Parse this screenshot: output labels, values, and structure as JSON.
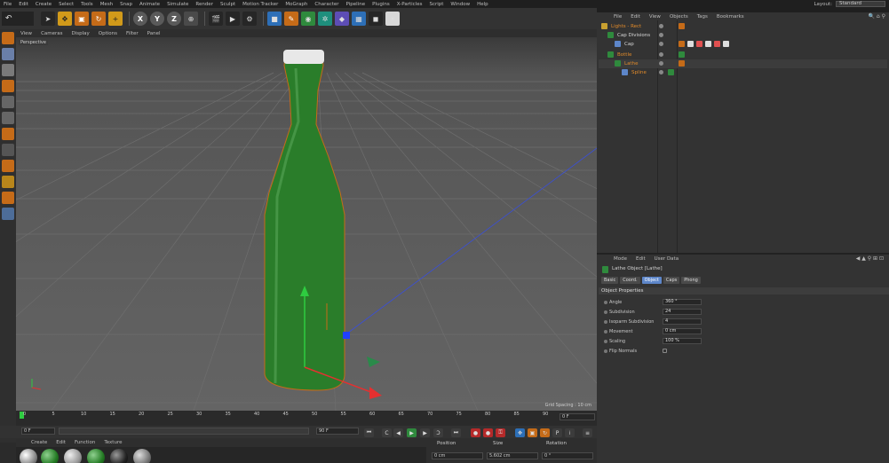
{
  "menubar": {
    "items": [
      "File",
      "Edit",
      "Create",
      "Select",
      "Tools",
      "Mesh",
      "Snap",
      "Animate",
      "Simulate",
      "Render",
      "Sculpt",
      "Motion Tracker",
      "MoGraph",
      "Character",
      "Pipeline",
      "Plugins",
      "X-Particles",
      "Script",
      "Window",
      "Help"
    ],
    "layout_label": "Layout:",
    "layout_value": "Standard"
  },
  "toolbar": {
    "undo_icon": "↶",
    "axis_x": "X",
    "axis_y": "Y",
    "axis_z": "Z"
  },
  "viewport": {
    "menu": [
      "View",
      "Cameras",
      "Display",
      "Options",
      "Filter",
      "Panel"
    ],
    "label": "Perspective",
    "grid_spacing": "Grid Spacing : 10 cm"
  },
  "timeline": {
    "ticks": [
      "0",
      "5",
      "10",
      "15",
      "20",
      "25",
      "30",
      "35",
      "40",
      "45",
      "50",
      "55",
      "60",
      "65",
      "70",
      "75",
      "80",
      "85",
      "90"
    ],
    "start_frame": "0 F",
    "current_field": "0 F",
    "end_frame": "90 F",
    "end_frame_right": "0 F"
  },
  "materials": {
    "menu": [
      "Create",
      "Edit",
      "Function",
      "Texture"
    ]
  },
  "coordinates": {
    "headers": [
      "Position",
      "Size",
      "Rotation"
    ],
    "values": [
      "0 cm",
      "5.602 cm",
      "0 °"
    ]
  },
  "object_manager": {
    "menu": [
      "File",
      "Edit",
      "View",
      "Objects",
      "Tags",
      "Bookmarks"
    ],
    "objects": [
      {
        "name": "Lights - Rect",
        "color": "orange"
      },
      {
        "name": "Cap Divisions",
        "color": "white"
      },
      {
        "name": "Cap",
        "color": "white"
      },
      {
        "name": "Bottle",
        "color": "orange"
      },
      {
        "name": "Lathe",
        "color": "orange"
      },
      {
        "name": "Spline",
        "color": "orange"
      }
    ]
  },
  "attribute_manager": {
    "menu": [
      "Mode",
      "Edit",
      "User Data"
    ],
    "title": "Lathe Object [Lathe]",
    "tabs": [
      "Basic",
      "Coord.",
      "Object",
      "Caps",
      "Phong"
    ],
    "active_tab": "Object",
    "section": "Object Properties",
    "props": [
      {
        "label": "Angle",
        "value": "360 °"
      },
      {
        "label": "Subdivision",
        "value": "24"
      },
      {
        "label": "Isoparm Subdivision",
        "value": "4"
      },
      {
        "label": "Movement",
        "value": "0 cm"
      },
      {
        "label": "Scaling",
        "value": "100 %"
      },
      {
        "label": "Flip Normals",
        "value": ""
      }
    ]
  },
  "colors": {
    "bottle": "#2a7d2a",
    "accent_orange": "#c56b18",
    "selection_blue": "#5d86c9"
  }
}
